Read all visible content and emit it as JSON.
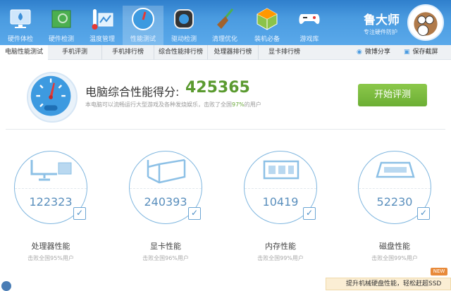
{
  "header": {
    "nav": [
      {
        "label": "硬件体检",
        "icon": "monitor-icon"
      },
      {
        "label": "硬件检测",
        "icon": "hardware-card-icon"
      },
      {
        "label": "温度管理",
        "icon": "thermometer-icon"
      },
      {
        "label": "性能测试",
        "icon": "speedometer-icon",
        "active": true
      },
      {
        "label": "驱动检测",
        "icon": "driver-gear-icon"
      },
      {
        "label": "清理优化",
        "icon": "broom-icon"
      },
      {
        "label": "装机必备",
        "icon": "cube-icon"
      },
      {
        "label": "游戏库",
        "icon": "gamepad-icon"
      }
    ],
    "brand": "鲁大师",
    "slogan": "专注硬件防护"
  },
  "tabs": [
    "电脑性能测试",
    "手机评测",
    "手机排行榜",
    "综合性能排行榜",
    "处理器排行榜",
    "显卡排行榜"
  ],
  "tools": {
    "weibo": "微博分享",
    "screenshot": "保存截屏"
  },
  "score": {
    "label": "电脑综合性能得分:",
    "value": "425365",
    "desc_prefix": "本电脑可以流畅运行大型游戏及各种发烧娱乐，击败了全国",
    "desc_percent": "97%",
    "desc_suffix": "的用户",
    "start_button": "开始评测"
  },
  "cards": [
    {
      "value": "122323",
      "label": "处理器性能",
      "sub": "击败全国95%用户",
      "icon": "cpu-monitor-icon"
    },
    {
      "value": "240393",
      "label": "显卡性能",
      "sub": "击败全国96%用户",
      "icon": "gpu-box-icon"
    },
    {
      "value": "10419",
      "label": "内存性能",
      "sub": "击败全国99%用户",
      "icon": "memory-icon"
    },
    {
      "value": "52230",
      "label": "磁盘性能",
      "sub": "击败全国99%用户",
      "icon": "disk-icon"
    }
  ],
  "banner": {
    "badge": "NEW",
    "text": "提升机械硬盘性能，轻松赶超SSD"
  },
  "colors": {
    "header": "#4a9be0",
    "score": "#5a9a2f",
    "button": "#7bbb3f",
    "card": "#7fb6df"
  }
}
